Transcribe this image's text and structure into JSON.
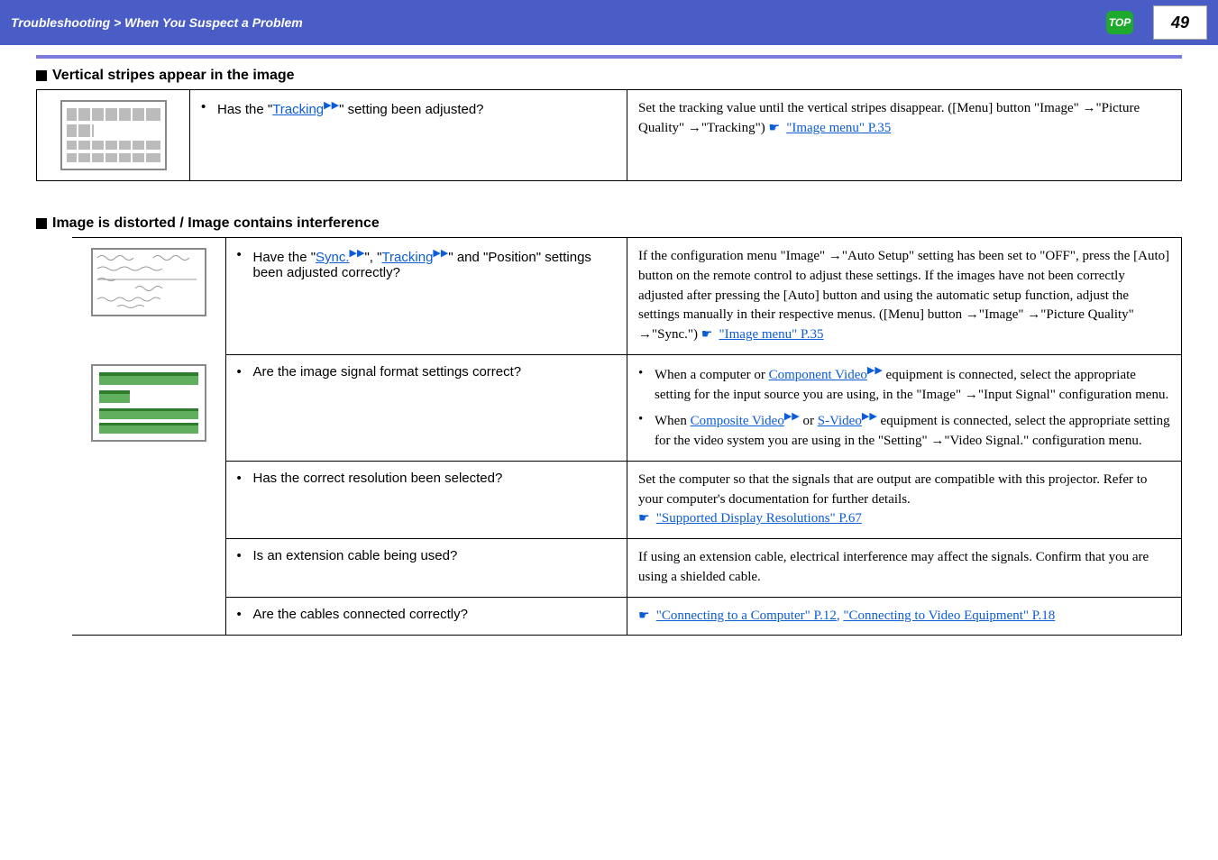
{
  "header": {
    "breadcrumb": "Troubleshooting > When You Suspect a Problem",
    "top_label": "TOP",
    "page_number": "49"
  },
  "section1": {
    "title": "Vertical stripes appear in the image",
    "row1": {
      "q_prefix": "Has the \"",
      "q_link": "Tracking",
      "q_suffix": "\" setting been adjusted?",
      "a_text1": "Set the tracking value until the vertical stripes disappear. ([Menu] button \"Image\" →\"Picture Quality\" →\"Tracking\") ",
      "a_link": "\"Image menu\" P.35"
    }
  },
  "section2": {
    "title": "Image is distorted / Image contains interference",
    "row1": {
      "q_prefix": "Have the \"",
      "q_link1": "Sync.",
      "q_mid": "\", \"",
      "q_link2": "Tracking",
      "q_suffix": "\" and \"Position\" settings been adjusted correctly?",
      "a_text": "If the configuration menu \"Image\" →\"Auto Setup\" setting has been set to \"OFF\", press the [Auto] button on the remote control to adjust these settings. If the images have not been correctly adjusted after pressing the [Auto] button and using the automatic setup function, adjust the settings manually in their respective menus. ([Menu] button →\"Image\" →\"Picture Quality\" →\"Sync.\") ",
      "a_link": "\"Image menu\" P.35"
    },
    "row2": {
      "q_text": "Are the image signal format settings correct?",
      "a_b1_pre": "When a computer or ",
      "a_b1_link": "Component Video",
      "a_b1_post": " equipment is connected, select the appropriate setting for the input source you are using, in the \"Image\" →\"Input Signal\" configuration menu.",
      "a_b2_pre": "When ",
      "a_b2_link1": "Composite Video",
      "a_b2_mid": " or ",
      "a_b2_link2": "S-Video",
      "a_b2_post": " equipment is connected, select the appropriate setting for the video system you are using in the \"Setting\" →\"Video Signal.\" configuration menu."
    },
    "row3": {
      "q_text": "Has the correct resolution been selected?",
      "a_text": "Set the computer so that the signals that are output are compatible with this projector. Refer to your computer's documentation for further details.",
      "a_link": "\"Supported Display Resolutions\" P.67"
    },
    "row4": {
      "q_text": "Is an extension cable being used?",
      "a_text": "If using an extension cable, electrical interference may affect the signals. Confirm that you are using a shielded cable."
    },
    "row5": {
      "q_text": "Are the cables connected correctly?",
      "a_link1": "\"Connecting to a Computer\" P.12",
      "a_mid": ", ",
      "a_link2": "\"Connecting to Video Equipment\" P.18"
    }
  }
}
